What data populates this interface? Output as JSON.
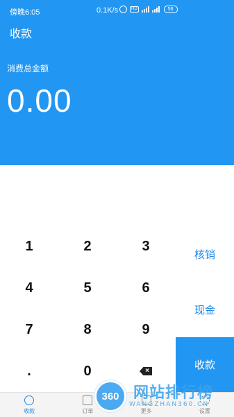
{
  "status_bar": {
    "time": "傍晚6:05",
    "network_speed": "0.1K/s",
    "hd_label": "HD",
    "battery": "56"
  },
  "app_bar": {
    "title": "收款"
  },
  "amount": {
    "label": "消费总金额",
    "value": "0.00"
  },
  "keypad": {
    "keys": [
      "1",
      "2",
      "3",
      "4",
      "5",
      "6",
      "7",
      "8",
      "9",
      ".",
      "0"
    ],
    "backspace_icon": "backspace-icon"
  },
  "side_buttons": {
    "verify": "核销",
    "cash": "现金",
    "collect": "收款"
  },
  "bottom_nav": {
    "items": [
      {
        "label": "收款",
        "icon": "collect-icon",
        "active": true
      },
      {
        "label": "订单",
        "icon": "order-icon",
        "active": false
      },
      {
        "label": "更多",
        "icon": "more-icon",
        "active": false
      },
      {
        "label": "设置",
        "icon": "settings-icon",
        "active": false
      }
    ]
  },
  "watermark": {
    "badge": "360",
    "title": "网站排行榜",
    "subtitle": "WANGZHAN360.CN"
  },
  "colors": {
    "primary": "#2196f3",
    "accent_text": "#1e88e5"
  }
}
